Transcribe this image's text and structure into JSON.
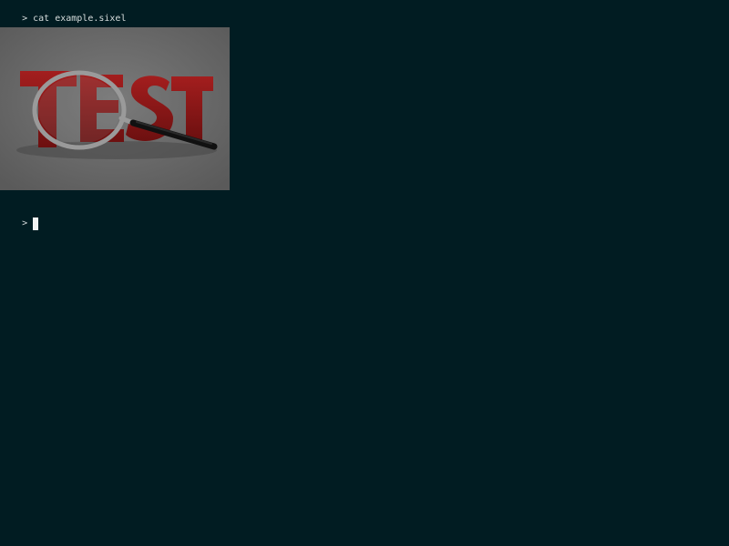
{
  "terminal": {
    "background": "#011c22",
    "foreground": "#d6dcdc",
    "lines": [
      {
        "prompt": ">",
        "command": "cat example.sixel"
      },
      {
        "prompt": ">",
        "command": ""
      }
    ],
    "image": {
      "word": "TEST",
      "icon": "magnifying-glass-icon",
      "letter_color": "#8a1a1a"
    },
    "cursor_color": "#f2f2f2"
  }
}
